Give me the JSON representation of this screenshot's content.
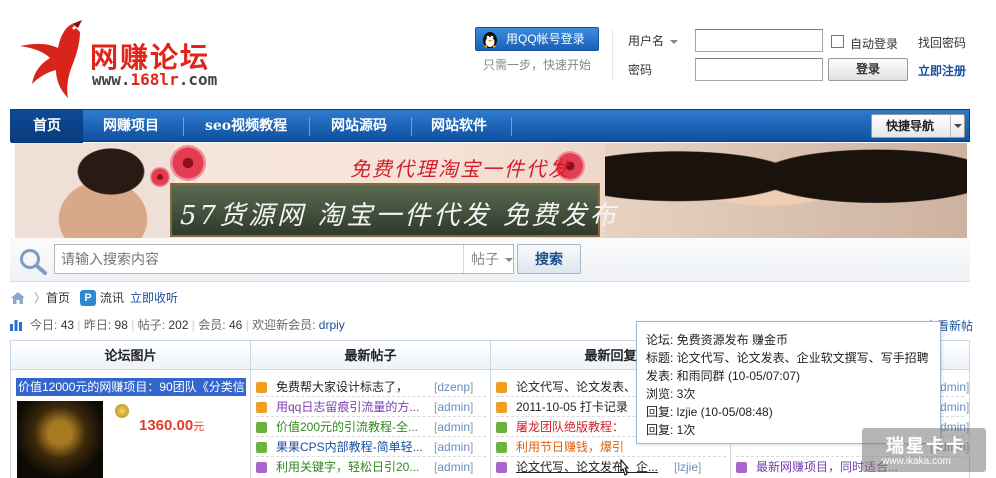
{
  "header": {
    "logo_text": "网赚论坛",
    "logo_url_prefix": "www.",
    "logo_url_red": "168lr",
    "logo_url_suffix": ".com",
    "qq_login_label": "用QQ帐号登录",
    "qq_sub": "只需一步，快速开始",
    "username_label": "用户名",
    "password_label": "密码",
    "auto_login_label": "自动登录",
    "forgot_password": "找回密码",
    "login_button": "登录",
    "register_link": "立即注册"
  },
  "nav": {
    "items": [
      "首页",
      "网赚项目",
      "seo视频教程",
      "网站源码",
      "网站软件"
    ],
    "quick_nav": "快捷导航"
  },
  "banner": {
    "slogan": "免费代理淘宝一件代发",
    "board_text": "57货源网 淘宝一件代发 免费发布"
  },
  "search": {
    "placeholder": "请输入搜索内容",
    "type": "帖子",
    "button": "搜索"
  },
  "breadcrumb": {
    "home": "首页",
    "p_badge": "P",
    "liuxun": "流讯",
    "listen_now": "立即收听"
  },
  "stats": {
    "today_label": "今日:",
    "today": "43",
    "yesterday_label": "昨日:",
    "yesterday": "98",
    "posts_label": "帖子:",
    "posts": "202",
    "members_label": "会员:",
    "members": "46",
    "welcome_label": "欢迎新会员:",
    "new_member": "drpiy",
    "new_posts_link": "查看新帖"
  },
  "table": {
    "headers": [
      "论坛图片",
      "最新帖子",
      "最新回复",
      "热帖"
    ],
    "pic_caption": "价值12000元的网赚项目：90团队《分类信",
    "pic_price": "1360.00",
    "pic_currency": "元",
    "latest_posts": [
      {
        "title": "免费帮大家设计标志了，",
        "author": "dzenp"
      },
      {
        "title": "用qq日志留痕引流量的方...",
        "author": "admin"
      },
      {
        "title": "价值200元的引流教程-全...",
        "author": "admin"
      },
      {
        "title": "果果CPS内部教程-简单轻...",
        "author": "admin"
      },
      {
        "title": "利用关键字，轻松日引20...",
        "author": "admin"
      }
    ],
    "latest_replies": [
      {
        "title": "论文代写、论文发表、",
        "author": "admin"
      },
      {
        "title": "2011-10-05 打卡记录",
        "author": "admin"
      },
      {
        "title": "屠龙团队绝版教程：",
        "author": "admin"
      },
      {
        "title": "利用节日赚钱，爆引",
        "author": "admin"
      },
      {
        "title": "论文代写、论文发布、企...",
        "author": "lzjie"
      }
    ],
    "hot_posts": [
      {
        "title": "",
        "author": "admin"
      },
      {
        "title": "",
        "author": "admin"
      },
      {
        "title": "",
        "author": "admin"
      },
      {
        "title": "",
        "author": "admin"
      },
      {
        "title": "最新网赚项目，同时适合...",
        "author": "admin"
      }
    ]
  },
  "tooltip": {
    "forum": "论坛: 免费资源发布 赚金币",
    "title": "标题: 论文代写、论文发表、企业软文撰写、写手招聘",
    "poster": "发表: 和雨同群 (10-05/07:07)",
    "views": "浏览: 3次",
    "reply": "回复: lzjie (10-05/08:48)",
    "replies": "回复: 1次"
  },
  "watermark": {
    "text": "瑞星卡卡",
    "url": "www.ikaka.com"
  },
  "colors": {
    "nav_blue": "#1f62b8",
    "link_blue": "#1b4fa0",
    "logo_red": "#e2231a"
  }
}
